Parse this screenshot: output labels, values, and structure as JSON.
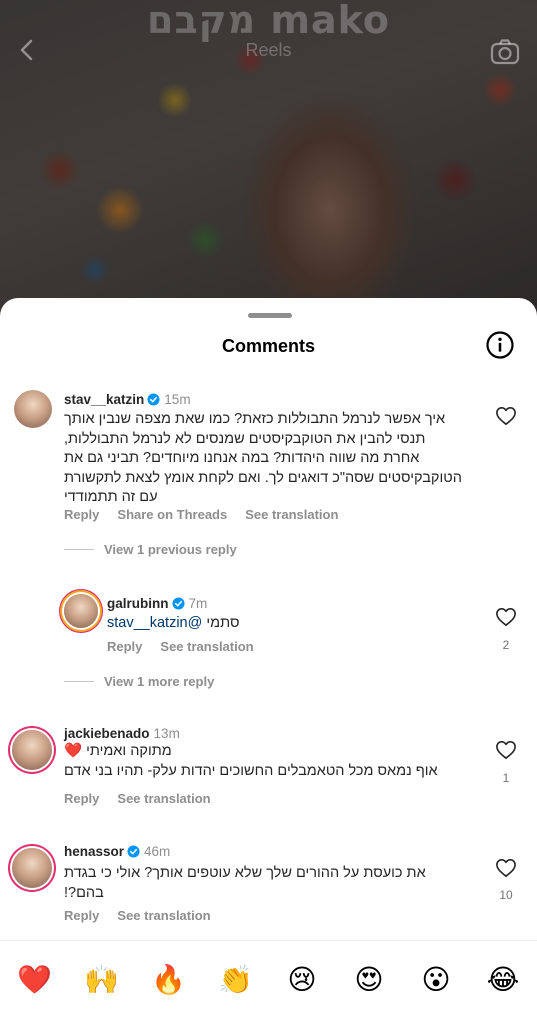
{
  "header": {
    "brand": "mako מקבם",
    "title": "Reels"
  },
  "sheet": {
    "title": "Comments"
  },
  "comments": [
    {
      "username": "stav__katzin",
      "time": "15m",
      "text": "איך אפשר לנרמל התבוללות כזאת? כמו שאת מצפה שנבין אותך תנסי להבין את הטוקבקיסטים שמנסים לא לנרמל התבוללות, אחרת מה שווה היהדות? במה אנחנו מיוחדים? תביני גם את הטוקבקיסטים שסה\"כ דואגים לך. ואם לקחת אומץ לצאת לתקשורת עם זה תתמודדי",
      "actions": [
        "Reply",
        "Share on Threads",
        "See translation"
      ],
      "view_replies": "View 1 previous reply"
    },
    {
      "username": "galrubinn",
      "time": "7m",
      "mention": "@stav__katzin",
      "text": "סתמי",
      "actions": [
        "Reply",
        "See translation"
      ],
      "likes": "2",
      "view_replies": "View 1 more reply"
    },
    {
      "username": "jackiebenado",
      "time": "13m",
      "text": "מתוקה ואמיתי ❤️\nאוף נמאס מכל הטאמבלים החשוכים יהדות עלק- תהיו בני אדם",
      "actions": [
        "Reply",
        "See translation"
      ],
      "likes": "1"
    },
    {
      "username": "henassor",
      "time": "46m",
      "text": "את כועסת על ההורים שלך שלא עוטפים אותך? אולי כי בגדת בהם?!",
      "actions": [
        "Reply",
        "See translation"
      ],
      "likes": "10"
    }
  ],
  "emoji_bar": [
    "❤️",
    "🙌",
    "🔥",
    "👏",
    "😢",
    "😍",
    "😮",
    "😂"
  ],
  "colors": {
    "verified": "#0095f6",
    "mention": "#00376b",
    "muted": "#8e8e8e"
  },
  "icons": [
    "back-arrow-icon",
    "camera-icon",
    "info-icon",
    "verified-badge-icon",
    "heart-outline-icon"
  ]
}
